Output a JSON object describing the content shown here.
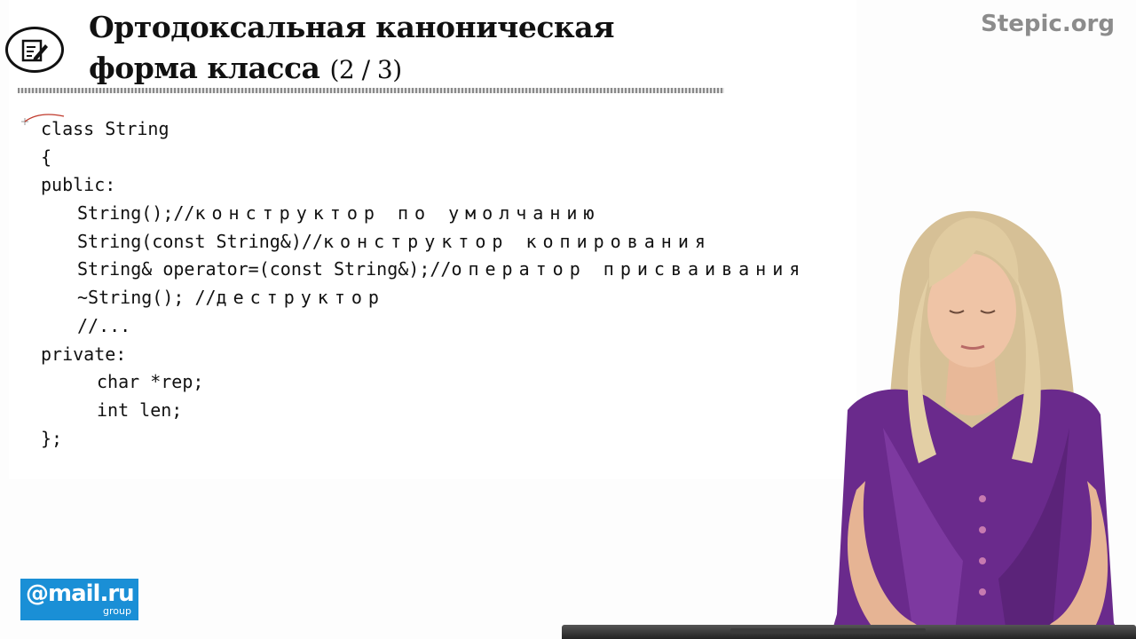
{
  "header": {
    "title_line1": "Ортодоксальная каноническая",
    "title_line2": "форма класса",
    "page": "(2 / 3)",
    "icon": "note-pencil-icon"
  },
  "brand": {
    "site": "Stepic.org",
    "partner_logo": "@mail.ru",
    "partner_sub": "group"
  },
  "code": {
    "l1": "class String",
    "l2": "{",
    "l3": "public:",
    "l4_code": "String();//",
    "l4_comment": "конструктор по умолчанию",
    "l5_code": "String(const String&)//",
    "l5_comment": "конструктор копирования",
    "l6_code": "String& operator=(const String&);//",
    "l6_comment": "оператор присваивания",
    "l7_code": "~String(); //",
    "l7_comment": "деструктор",
    "l8": "//...",
    "l9": "private:",
    "l10": "char *rep;",
    "l11": "int len;",
    "l12": "};"
  },
  "colors": {
    "title": "#111111",
    "stepic": "#8c8c8c",
    "mailru_bg": "#1a8fd6",
    "blouse": "#6a2a8c",
    "hair": "#d8c39a"
  }
}
